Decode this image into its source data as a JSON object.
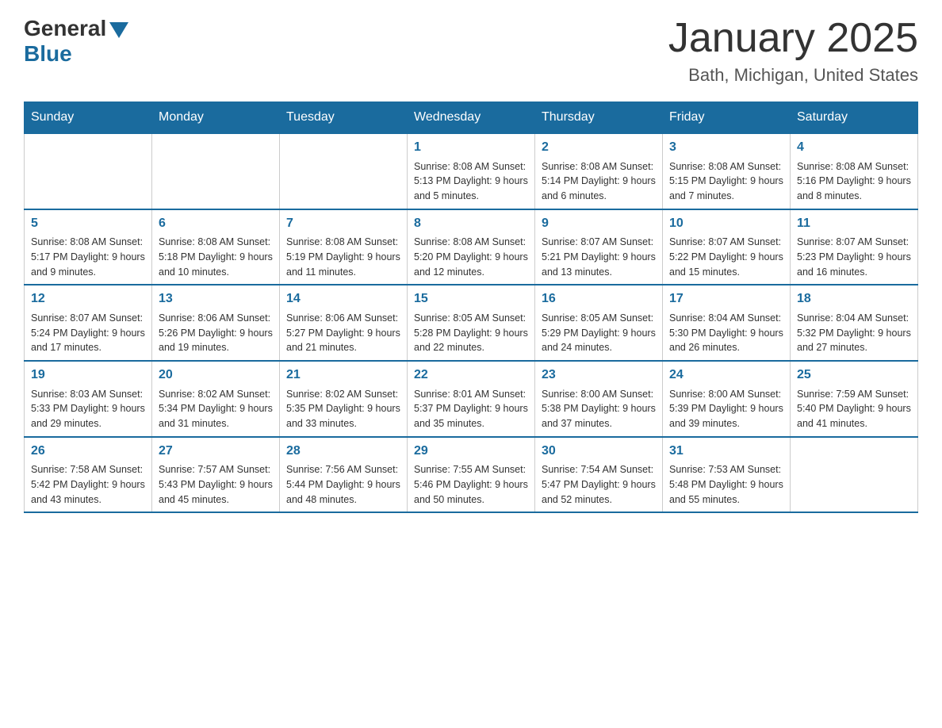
{
  "header": {
    "logo_general": "General",
    "logo_blue": "Blue",
    "month_title": "January 2025",
    "location": "Bath, Michigan, United States"
  },
  "days_of_week": [
    "Sunday",
    "Monday",
    "Tuesday",
    "Wednesday",
    "Thursday",
    "Friday",
    "Saturday"
  ],
  "weeks": [
    [
      {
        "day": "",
        "info": ""
      },
      {
        "day": "",
        "info": ""
      },
      {
        "day": "",
        "info": ""
      },
      {
        "day": "1",
        "info": "Sunrise: 8:08 AM\nSunset: 5:13 PM\nDaylight: 9 hours and 5 minutes."
      },
      {
        "day": "2",
        "info": "Sunrise: 8:08 AM\nSunset: 5:14 PM\nDaylight: 9 hours and 6 minutes."
      },
      {
        "day": "3",
        "info": "Sunrise: 8:08 AM\nSunset: 5:15 PM\nDaylight: 9 hours and 7 minutes."
      },
      {
        "day": "4",
        "info": "Sunrise: 8:08 AM\nSunset: 5:16 PM\nDaylight: 9 hours and 8 minutes."
      }
    ],
    [
      {
        "day": "5",
        "info": "Sunrise: 8:08 AM\nSunset: 5:17 PM\nDaylight: 9 hours and 9 minutes."
      },
      {
        "day": "6",
        "info": "Sunrise: 8:08 AM\nSunset: 5:18 PM\nDaylight: 9 hours and 10 minutes."
      },
      {
        "day": "7",
        "info": "Sunrise: 8:08 AM\nSunset: 5:19 PM\nDaylight: 9 hours and 11 minutes."
      },
      {
        "day": "8",
        "info": "Sunrise: 8:08 AM\nSunset: 5:20 PM\nDaylight: 9 hours and 12 minutes."
      },
      {
        "day": "9",
        "info": "Sunrise: 8:07 AM\nSunset: 5:21 PM\nDaylight: 9 hours and 13 minutes."
      },
      {
        "day": "10",
        "info": "Sunrise: 8:07 AM\nSunset: 5:22 PM\nDaylight: 9 hours and 15 minutes."
      },
      {
        "day": "11",
        "info": "Sunrise: 8:07 AM\nSunset: 5:23 PM\nDaylight: 9 hours and 16 minutes."
      }
    ],
    [
      {
        "day": "12",
        "info": "Sunrise: 8:07 AM\nSunset: 5:24 PM\nDaylight: 9 hours and 17 minutes."
      },
      {
        "day": "13",
        "info": "Sunrise: 8:06 AM\nSunset: 5:26 PM\nDaylight: 9 hours and 19 minutes."
      },
      {
        "day": "14",
        "info": "Sunrise: 8:06 AM\nSunset: 5:27 PM\nDaylight: 9 hours and 21 minutes."
      },
      {
        "day": "15",
        "info": "Sunrise: 8:05 AM\nSunset: 5:28 PM\nDaylight: 9 hours and 22 minutes."
      },
      {
        "day": "16",
        "info": "Sunrise: 8:05 AM\nSunset: 5:29 PM\nDaylight: 9 hours and 24 minutes."
      },
      {
        "day": "17",
        "info": "Sunrise: 8:04 AM\nSunset: 5:30 PM\nDaylight: 9 hours and 26 minutes."
      },
      {
        "day": "18",
        "info": "Sunrise: 8:04 AM\nSunset: 5:32 PM\nDaylight: 9 hours and 27 minutes."
      }
    ],
    [
      {
        "day": "19",
        "info": "Sunrise: 8:03 AM\nSunset: 5:33 PM\nDaylight: 9 hours and 29 minutes."
      },
      {
        "day": "20",
        "info": "Sunrise: 8:02 AM\nSunset: 5:34 PM\nDaylight: 9 hours and 31 minutes."
      },
      {
        "day": "21",
        "info": "Sunrise: 8:02 AM\nSunset: 5:35 PM\nDaylight: 9 hours and 33 minutes."
      },
      {
        "day": "22",
        "info": "Sunrise: 8:01 AM\nSunset: 5:37 PM\nDaylight: 9 hours and 35 minutes."
      },
      {
        "day": "23",
        "info": "Sunrise: 8:00 AM\nSunset: 5:38 PM\nDaylight: 9 hours and 37 minutes."
      },
      {
        "day": "24",
        "info": "Sunrise: 8:00 AM\nSunset: 5:39 PM\nDaylight: 9 hours and 39 minutes."
      },
      {
        "day": "25",
        "info": "Sunrise: 7:59 AM\nSunset: 5:40 PM\nDaylight: 9 hours and 41 minutes."
      }
    ],
    [
      {
        "day": "26",
        "info": "Sunrise: 7:58 AM\nSunset: 5:42 PM\nDaylight: 9 hours and 43 minutes."
      },
      {
        "day": "27",
        "info": "Sunrise: 7:57 AM\nSunset: 5:43 PM\nDaylight: 9 hours and 45 minutes."
      },
      {
        "day": "28",
        "info": "Sunrise: 7:56 AM\nSunset: 5:44 PM\nDaylight: 9 hours and 48 minutes."
      },
      {
        "day": "29",
        "info": "Sunrise: 7:55 AM\nSunset: 5:46 PM\nDaylight: 9 hours and 50 minutes."
      },
      {
        "day": "30",
        "info": "Sunrise: 7:54 AM\nSunset: 5:47 PM\nDaylight: 9 hours and 52 minutes."
      },
      {
        "day": "31",
        "info": "Sunrise: 7:53 AM\nSunset: 5:48 PM\nDaylight: 9 hours and 55 minutes."
      },
      {
        "day": "",
        "info": ""
      }
    ]
  ]
}
